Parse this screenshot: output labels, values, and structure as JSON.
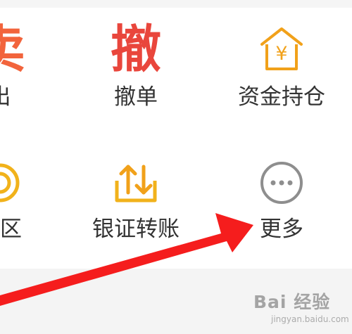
{
  "menu_items": [
    {
      "label": "出",
      "icon_text": "卖",
      "icon_name": "sell-icon"
    },
    {
      "label": "撤单",
      "icon_text": "撤",
      "icon_name": "cancel-order-icon"
    },
    {
      "label": "资金持仓",
      "icon_text": "¥",
      "icon_name": "funds-holdings-icon"
    },
    {
      "label": "专区",
      "icon_name": "zone-icon"
    },
    {
      "label": "银证转账",
      "icon_name": "transfer-icon"
    },
    {
      "label": "更多",
      "icon_name": "more-icon"
    }
  ],
  "watermark": {
    "main": "Bai 经验",
    "sub": "jingyan.baidu.com"
  },
  "colors": {
    "cancel_red": "#e9463c",
    "icon_orange": "#f1a11a",
    "sell_orange": "#f2643c",
    "zone_yellow": "#f1b21b",
    "more_gray": "#8e8e8e",
    "arrow_red": "#f51d1d"
  }
}
